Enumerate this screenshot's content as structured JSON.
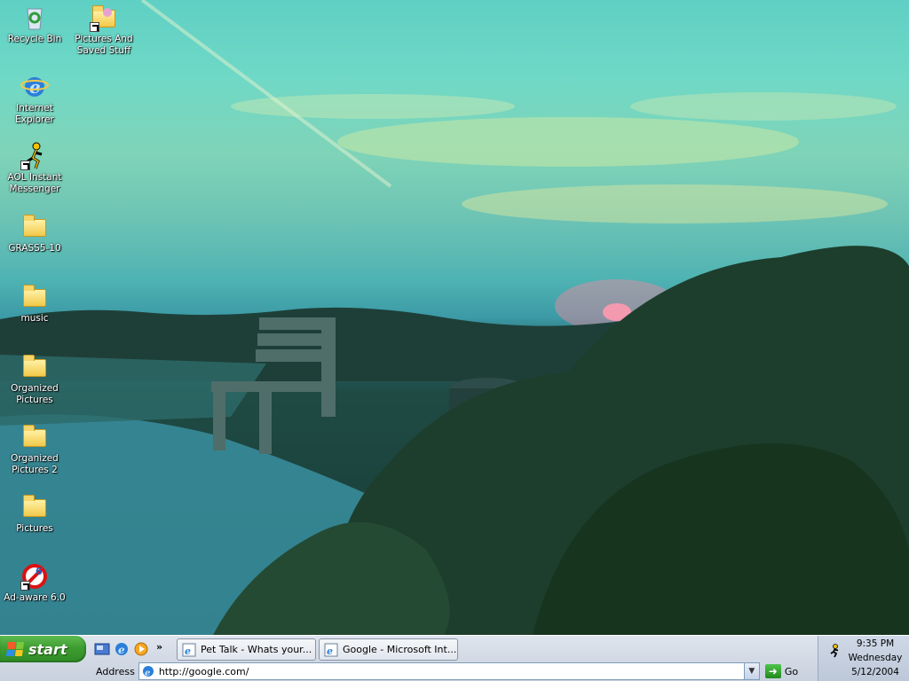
{
  "desktop": {
    "icons": [
      {
        "id": "recycle-bin",
        "label_lines": [
          "Recycle Bin"
        ]
      },
      {
        "id": "pictures-and-saved-stuff",
        "label_lines": [
          "Pictures And",
          "Saved Stuff"
        ]
      },
      {
        "id": "internet-explorer",
        "label_lines": [
          "Internet",
          "Explorer"
        ]
      },
      {
        "id": "aol-instant-messenger",
        "label_lines": [
          "AOL Instant",
          "Messenger"
        ]
      },
      {
        "id": "grass5-10",
        "label_lines": [
          "GRASS5-10"
        ]
      },
      {
        "id": "music",
        "label_lines": [
          "music"
        ]
      },
      {
        "id": "organized-pictures",
        "label_lines": [
          "Organized",
          "Pictures"
        ]
      },
      {
        "id": "organized-pictures-2",
        "label_lines": [
          "Organized",
          "Pictures 2"
        ]
      },
      {
        "id": "pictures",
        "label_lines": [
          "Pictures"
        ]
      },
      {
        "id": "ad-aware",
        "label_lines": [
          "Ad-aware 6.0"
        ]
      }
    ]
  },
  "taskbar": {
    "start_label": "start",
    "quick_launch": [
      "show-desktop-icon",
      "internet-explorer-icon",
      "media-player-icon"
    ],
    "overflow_chevron": "»",
    "tasks": [
      {
        "label": "Pet Talk - Whats your..."
      },
      {
        "label": "Google - Microsoft Int..."
      }
    ],
    "address": {
      "label": "Address",
      "value": "http://google.com/",
      "go_label": "Go"
    },
    "clock": {
      "time": "9:35 PM",
      "day": "Wednesday",
      "date": "5/12/2004"
    }
  },
  "colors": {
    "start_green": "#3e9d30",
    "taskbar_bg": "#d4dbe6",
    "sky_teal": "#6fd8c6"
  }
}
